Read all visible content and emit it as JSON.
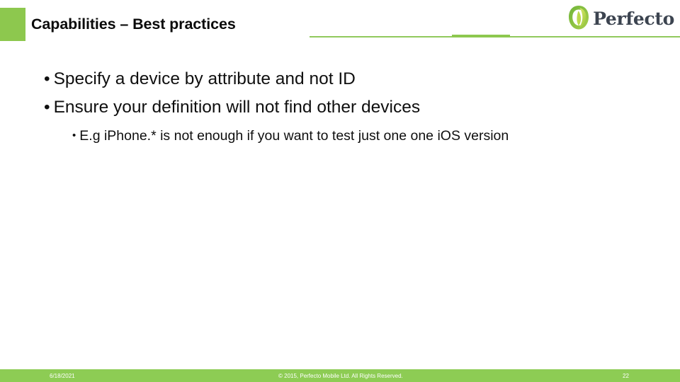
{
  "slide": {
    "title": "Capabilities – Best practices",
    "accent_color": "#8dc84e",
    "rule_color": "#91c95c",
    "footer_bar_color": "#8dcc54",
    "title_color": "#0a0a0a",
    "body_text_color": "#0f0f0f"
  },
  "logo": {
    "icon": "perfecto-leaf-icon",
    "wordmark": "Perfecto",
    "wordmark_color": "#3c4450",
    "leaf_outer_color": "#7fbf3f",
    "leaf_inner_color": "#c3d94e"
  },
  "content": {
    "bullets": [
      {
        "marker": "•",
        "text": "Specify a device by attribute and not ID",
        "level": 1
      },
      {
        "marker": "•",
        "text": "Ensure your definition will not find other devices",
        "level": 1
      },
      {
        "marker": "•",
        "text": "E.g iPhone.* is not enough if you want to test just one one iOS version",
        "level": 2
      }
    ]
  },
  "footer": {
    "date": "6/18/2021",
    "copyright": "© 2015, Perfecto Mobile Ltd. All Rights Reserved.",
    "page_number": "22"
  }
}
